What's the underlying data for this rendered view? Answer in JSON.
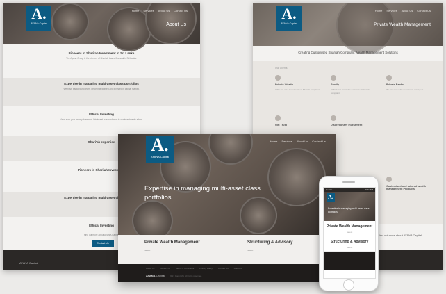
{
  "brand": {
    "logo_letter": "A.",
    "logo_subtext": "AYANA Capital",
    "footer_brand": "AYANA",
    "footer_brand_suffix": "Capital",
    "color_primary": "#0c5b83"
  },
  "left_page": {
    "hero_title": "About Us",
    "nav": [
      "Home",
      "Services",
      "About Us",
      "Contact Us"
    ],
    "sections": [
      {
        "heading": "Pioneers in Shari'ah Investment in Sri Lanka",
        "text": "The Ayana Group is the pioneer of Shari'ah based financial in Sri Lanka."
      },
      {
        "heading": "Expertise in managing multi-asset class portfolios",
        "text": "We have background team, which has worked and invested in capital market."
      },
      {
        "heading": "Ethical Investing",
        "text": "Make sure your money does real. We invest in accordance to our investments ethics."
      },
      {
        "heading": "Shari'ah expertise",
        "text": ""
      },
      {
        "heading": "Pioneers in Shari'ah Investment",
        "text": ""
      },
      {
        "heading": "Expertise in managing multi-asset class portfolios",
        "text": ""
      },
      {
        "heading": "Ethical Investing",
        "text": ""
      }
    ],
    "cta_text": "Find out more about AYANA Capital",
    "cta_button": "Contact Us"
  },
  "right_page": {
    "hero_title": "Private Wealth Management",
    "nav": [
      "Home",
      "Services",
      "About Us",
      "Contact Us"
    ],
    "tagline": "Creating Customised Shari'ah Compliant Wealth Management Solutions",
    "section_label": "Our Clients",
    "services": [
      {
        "icon": "user-icon",
        "title": "Private Wealth",
        "desc": "While we offer investments in Shariah compliant."
      },
      {
        "icon": "building-icon",
        "title": "Family",
        "desc": "AYANA has created a customised Shariah compliant."
      },
      {
        "icon": "lock-icon",
        "title": "Private Banks",
        "desc": "We are one of the investment managers."
      },
      {
        "icon": "hand-icon",
        "title": "Gift Trust",
        "desc": ""
      },
      {
        "icon": "chart-icon",
        "title": "Discretionary Investment",
        "desc": ""
      },
      {
        "icon": "globe-icon",
        "title": "Customised and tailored wealth management Products",
        "desc": ""
      }
    ],
    "cta_text": "Find out more about AYANA Capital"
  },
  "main_page": {
    "nav": [
      "Home",
      "Services",
      "About Us",
      "Contact Us"
    ],
    "headline": "Expertise in managing multi-asset class portfolios",
    "cards": [
      {
        "title": "Private Wealth Management",
        "mini": [
          "Select",
          "Select"
        ]
      },
      {
        "title": "Structuring & Advisory",
        "mini": [
          "Select",
          "Select"
        ]
      }
    ],
    "footer_links": [
      "About Us",
      "Contact Us",
      "Terms & Conditions",
      "Privacy Policy",
      "Contact Us",
      "About Us"
    ],
    "footer_tail": "2017 Copyright. All rights reserved."
  },
  "phone": {
    "carrier": "Carrier",
    "time": "9:41 AM",
    "hero_text": "Expertise in managing multi-asset class portfolios",
    "cards": [
      {
        "title": "Private Wealth Management",
        "mini": "Select"
      },
      {
        "title": "Structuring & Advisory",
        "mini": "Select"
      }
    ]
  }
}
